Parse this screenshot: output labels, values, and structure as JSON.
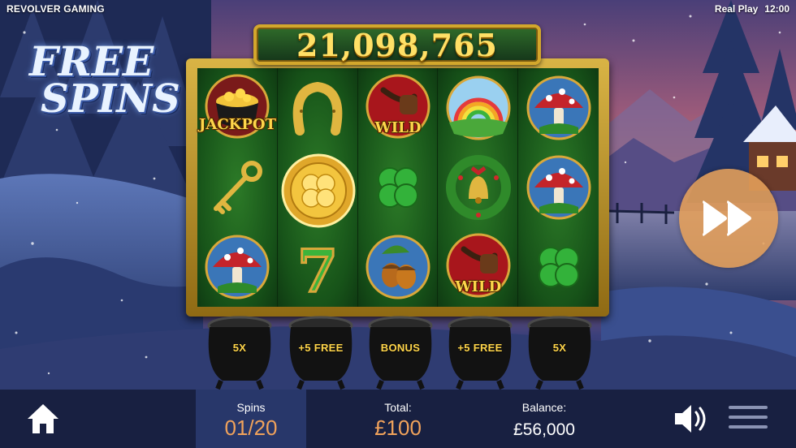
{
  "header": {
    "brand": "REVOLVER GAMING",
    "mode": "Real Play",
    "clock": "12:00"
  },
  "logo": {
    "line1": "FREE",
    "line2": "SPINS"
  },
  "win_total": "21,098,765",
  "reels": [
    [
      {
        "icon": "pot-of-gold-icon",
        "label": "JACKPOT"
      },
      {
        "icon": "golden-key-icon",
        "label": ""
      },
      {
        "icon": "red-mushroom-icon",
        "label": ""
      }
    ],
    [
      {
        "icon": "horseshoe-icon",
        "label": ""
      },
      {
        "icon": "gold-clover-coin-icon",
        "label": ""
      },
      {
        "icon": "green-seven-icon",
        "label": "7"
      }
    ],
    [
      {
        "icon": "pipe-icon",
        "label": "WILD"
      },
      {
        "icon": "four-leaf-clover-icon",
        "label": ""
      },
      {
        "icon": "acorns-icon",
        "label": ""
      }
    ],
    [
      {
        "icon": "rainbow-icon",
        "label": ""
      },
      {
        "icon": "bell-wreath-icon",
        "label": ""
      },
      {
        "icon": "pipe-icon",
        "label": "WILD"
      }
    ],
    [
      {
        "icon": "red-mushroom-icon",
        "label": ""
      },
      {
        "icon": "red-mushroom-icon",
        "label": ""
      },
      {
        "icon": "four-leaf-clover-icon",
        "label": ""
      }
    ]
  ],
  "pots": [
    "5X",
    "+5 FREE",
    "BONUS",
    "+5 FREE",
    "5X"
  ],
  "bottom_bar": {
    "spins_label": "Spins",
    "spins_value": "01/20",
    "total_label": "Total:",
    "total_value": "£100",
    "balance_label": "Balance:",
    "balance_value": "£56,000"
  },
  "colors": {
    "accent": "#f0a25b",
    "gold": "#ffd64a",
    "bar": "#182041",
    "spins_box": "#28376a"
  }
}
